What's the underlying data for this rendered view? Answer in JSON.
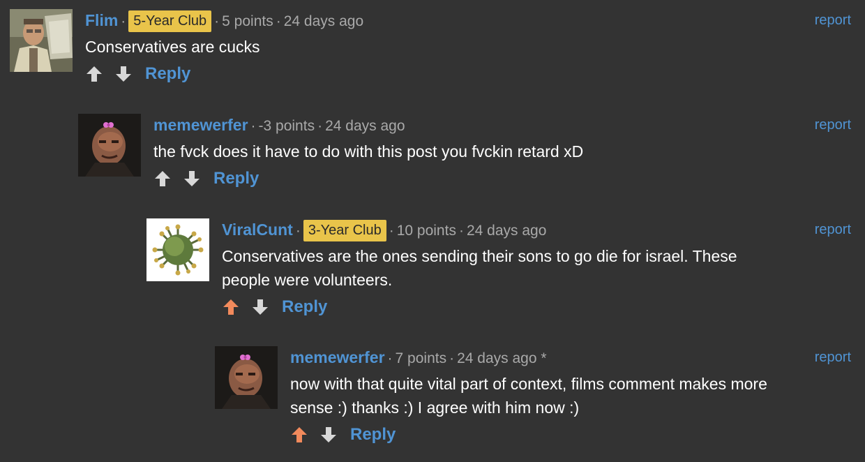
{
  "colors": {
    "background": "#333333",
    "link": "#5094d4",
    "badge": "#e9c44a",
    "meta_text": "#a9a9a9",
    "body_text": "#ffffff",
    "vote_active": "#f28a5c",
    "vote_inactive": "#d8d8d8"
  },
  "comments": [
    {
      "author": "Flim",
      "badge": "5-Year Club",
      "points": "5 points",
      "time": "24 days ago",
      "report": "report",
      "text": "Conservatives are cucks",
      "reply": "Reply",
      "upvoted": false,
      "avatar_icon": "man-reading-paper-avatar"
    },
    {
      "author": "memewerfer",
      "badge": "",
      "points": "-3 points",
      "time": "24 days ago",
      "report": "report",
      "text": "the fvck does it have to do with this post you fvckin retard xD",
      "reply": "Reply",
      "upvoted": false,
      "avatar_icon": "man-with-bow-avatar"
    },
    {
      "author": "ViralCunt",
      "badge": "3-Year Club",
      "points": "10 points",
      "time": "24 days ago",
      "report": "report",
      "text": "Conservatives are the ones sending their sons to go die for israel. These\npeople were volunteers.",
      "reply": "Reply",
      "upvoted": true,
      "avatar_icon": "virus-avatar"
    },
    {
      "author": "memewerfer",
      "badge": "",
      "points": "7 points",
      "time": "24 days ago *",
      "report": "report",
      "text": "now with that quite vital part of context, films comment makes more\nsense :) thanks :) I agree with him now :)",
      "reply": "Reply",
      "upvoted": true,
      "avatar_icon": "man-with-bow-avatar"
    }
  ]
}
